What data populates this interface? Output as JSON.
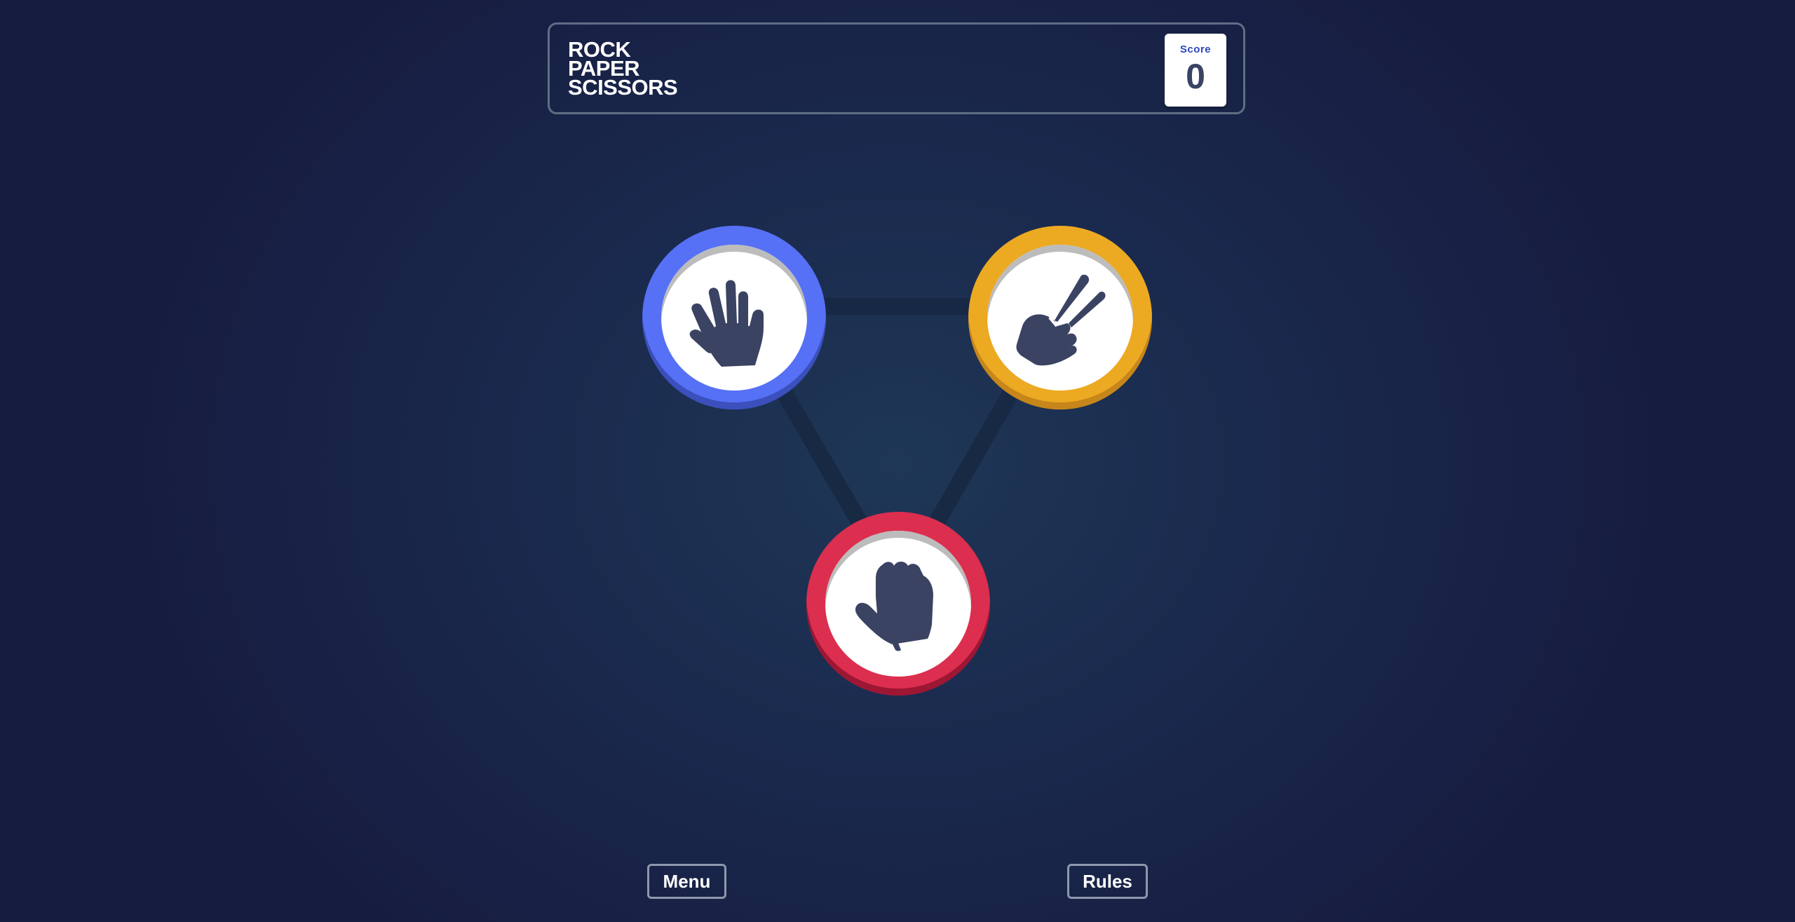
{
  "header": {
    "title_lines": [
      "ROCK",
      "PAPER",
      "SCISSORS"
    ],
    "score_label": "Score",
    "score_value": "0"
  },
  "tokens": [
    {
      "id": "paper",
      "icon": "paper-hand-icon",
      "color": "#5671f5"
    },
    {
      "id": "scissors",
      "icon": "scissors-hand-icon",
      "color": "#eca922"
    },
    {
      "id": "rock",
      "icon": "rock-fist-icon",
      "color": "#dc2e4e"
    }
  ],
  "buttons": {
    "menu_label": "Menu",
    "rules_label": "Rules"
  },
  "colors": {
    "background": "#1a2a4e",
    "icon": "#3b4363",
    "score_label": "#2a46c0"
  }
}
